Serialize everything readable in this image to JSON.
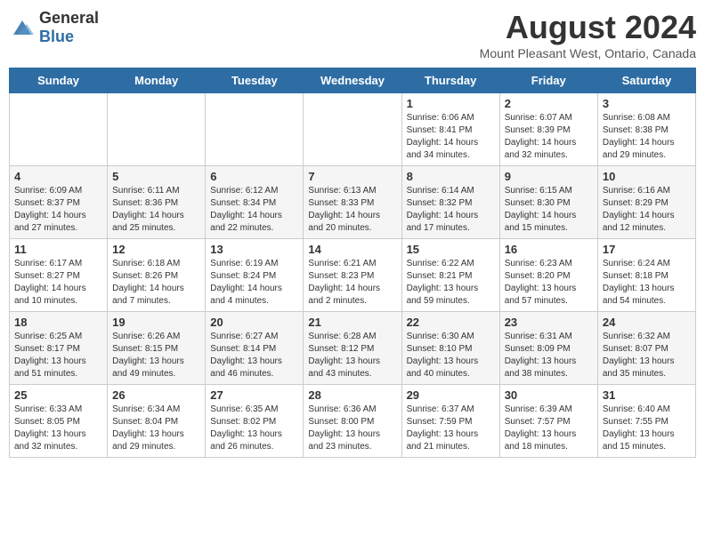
{
  "header": {
    "logo_general": "General",
    "logo_blue": "Blue",
    "title": "August 2024",
    "subtitle": "Mount Pleasant West, Ontario, Canada"
  },
  "days_of_week": [
    "Sunday",
    "Monday",
    "Tuesday",
    "Wednesday",
    "Thursday",
    "Friday",
    "Saturday"
  ],
  "weeks": [
    [
      {
        "day": "",
        "info": ""
      },
      {
        "day": "",
        "info": ""
      },
      {
        "day": "",
        "info": ""
      },
      {
        "day": "",
        "info": ""
      },
      {
        "day": "1",
        "info": "Sunrise: 6:06 AM\nSunset: 8:41 PM\nDaylight: 14 hours\nand 34 minutes."
      },
      {
        "day": "2",
        "info": "Sunrise: 6:07 AM\nSunset: 8:39 PM\nDaylight: 14 hours\nand 32 minutes."
      },
      {
        "day": "3",
        "info": "Sunrise: 6:08 AM\nSunset: 8:38 PM\nDaylight: 14 hours\nand 29 minutes."
      }
    ],
    [
      {
        "day": "4",
        "info": "Sunrise: 6:09 AM\nSunset: 8:37 PM\nDaylight: 14 hours\nand 27 minutes."
      },
      {
        "day": "5",
        "info": "Sunrise: 6:11 AM\nSunset: 8:36 PM\nDaylight: 14 hours\nand 25 minutes."
      },
      {
        "day": "6",
        "info": "Sunrise: 6:12 AM\nSunset: 8:34 PM\nDaylight: 14 hours\nand 22 minutes."
      },
      {
        "day": "7",
        "info": "Sunrise: 6:13 AM\nSunset: 8:33 PM\nDaylight: 14 hours\nand 20 minutes."
      },
      {
        "day": "8",
        "info": "Sunrise: 6:14 AM\nSunset: 8:32 PM\nDaylight: 14 hours\nand 17 minutes."
      },
      {
        "day": "9",
        "info": "Sunrise: 6:15 AM\nSunset: 8:30 PM\nDaylight: 14 hours\nand 15 minutes."
      },
      {
        "day": "10",
        "info": "Sunrise: 6:16 AM\nSunset: 8:29 PM\nDaylight: 14 hours\nand 12 minutes."
      }
    ],
    [
      {
        "day": "11",
        "info": "Sunrise: 6:17 AM\nSunset: 8:27 PM\nDaylight: 14 hours\nand 10 minutes."
      },
      {
        "day": "12",
        "info": "Sunrise: 6:18 AM\nSunset: 8:26 PM\nDaylight: 14 hours\nand 7 minutes."
      },
      {
        "day": "13",
        "info": "Sunrise: 6:19 AM\nSunset: 8:24 PM\nDaylight: 14 hours\nand 4 minutes."
      },
      {
        "day": "14",
        "info": "Sunrise: 6:21 AM\nSunset: 8:23 PM\nDaylight: 14 hours\nand 2 minutes."
      },
      {
        "day": "15",
        "info": "Sunrise: 6:22 AM\nSunset: 8:21 PM\nDaylight: 13 hours\nand 59 minutes."
      },
      {
        "day": "16",
        "info": "Sunrise: 6:23 AM\nSunset: 8:20 PM\nDaylight: 13 hours\nand 57 minutes."
      },
      {
        "day": "17",
        "info": "Sunrise: 6:24 AM\nSunset: 8:18 PM\nDaylight: 13 hours\nand 54 minutes."
      }
    ],
    [
      {
        "day": "18",
        "info": "Sunrise: 6:25 AM\nSunset: 8:17 PM\nDaylight: 13 hours\nand 51 minutes."
      },
      {
        "day": "19",
        "info": "Sunrise: 6:26 AM\nSunset: 8:15 PM\nDaylight: 13 hours\nand 49 minutes."
      },
      {
        "day": "20",
        "info": "Sunrise: 6:27 AM\nSunset: 8:14 PM\nDaylight: 13 hours\nand 46 minutes."
      },
      {
        "day": "21",
        "info": "Sunrise: 6:28 AM\nSunset: 8:12 PM\nDaylight: 13 hours\nand 43 minutes."
      },
      {
        "day": "22",
        "info": "Sunrise: 6:30 AM\nSunset: 8:10 PM\nDaylight: 13 hours\nand 40 minutes."
      },
      {
        "day": "23",
        "info": "Sunrise: 6:31 AM\nSunset: 8:09 PM\nDaylight: 13 hours\nand 38 minutes."
      },
      {
        "day": "24",
        "info": "Sunrise: 6:32 AM\nSunset: 8:07 PM\nDaylight: 13 hours\nand 35 minutes."
      }
    ],
    [
      {
        "day": "25",
        "info": "Sunrise: 6:33 AM\nSunset: 8:05 PM\nDaylight: 13 hours\nand 32 minutes."
      },
      {
        "day": "26",
        "info": "Sunrise: 6:34 AM\nSunset: 8:04 PM\nDaylight: 13 hours\nand 29 minutes."
      },
      {
        "day": "27",
        "info": "Sunrise: 6:35 AM\nSunset: 8:02 PM\nDaylight: 13 hours\nand 26 minutes."
      },
      {
        "day": "28",
        "info": "Sunrise: 6:36 AM\nSunset: 8:00 PM\nDaylight: 13 hours\nand 23 minutes."
      },
      {
        "day": "29",
        "info": "Sunrise: 6:37 AM\nSunset: 7:59 PM\nDaylight: 13 hours\nand 21 minutes."
      },
      {
        "day": "30",
        "info": "Sunrise: 6:39 AM\nSunset: 7:57 PM\nDaylight: 13 hours\nand 18 minutes."
      },
      {
        "day": "31",
        "info": "Sunrise: 6:40 AM\nSunset: 7:55 PM\nDaylight: 13 hours\nand 15 minutes."
      }
    ]
  ]
}
